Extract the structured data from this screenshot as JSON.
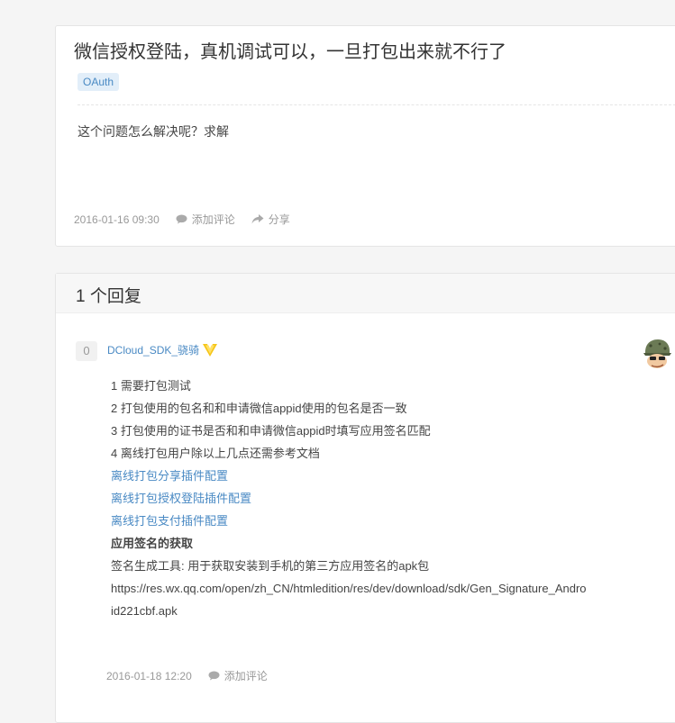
{
  "question": {
    "title": "微信授权登陆，真机调试可以，一旦打包出来就不行了",
    "tag": "OAuth",
    "body": "这个问题怎么解决呢？求解",
    "date": "2016-01-16 09:30",
    "comment_label": "添加评论",
    "share_label": "分享"
  },
  "answers": {
    "header": "1 个回复",
    "items": [
      {
        "votes": "0",
        "author": "DCloud_SDK_骁骑",
        "lines": [
          "1 需要打包测试",
          "2 打包使用的包名和和申请微信appid使用的包名是否一致",
          "3 打包使用的证书是否和和申请微信appid时填写应用签名匹配",
          "4 离线打包用户除以上几点还需参考文档"
        ],
        "links": [
          "离线打包分享插件配置",
          "离线打包授权登陆插件配置",
          "离线打包支付插件配置"
        ],
        "bold_heading": "应用签名的获取",
        "tool_line": "签名生成工具: 用于获取安装到手机的第三方应用签名的apk包",
        "url_line": "https://res.wx.qq.com/open/zh_CN/htmledition/res/dev/download/sdk/Gen_Signature_Android221cbf.apk",
        "date": "2016-01-18 12:20",
        "comment_label": "添加评论"
      }
    ]
  },
  "colors": {
    "accent": "#4a8ac4",
    "tag_bg": "#e2eef9",
    "muted": "#999999"
  }
}
